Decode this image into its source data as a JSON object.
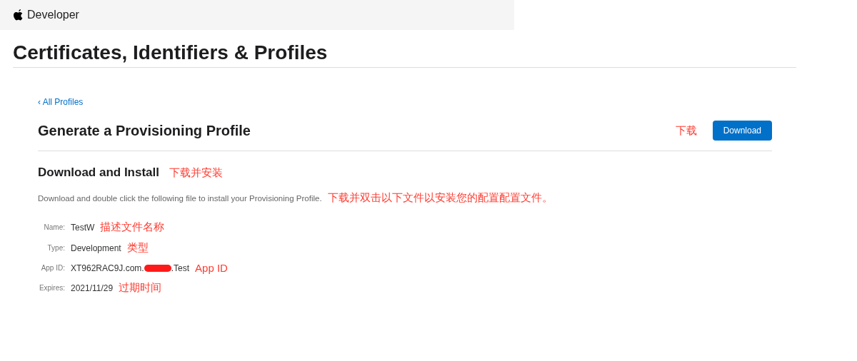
{
  "header": {
    "brand": "Developer"
  },
  "page_title": "Certificates, Identifiers & Profiles",
  "back_link": "‹ All Profiles",
  "section_title": "Generate a Provisioning Profile",
  "download_note": "下载",
  "download_button": "Download",
  "install": {
    "title": "Download and Install",
    "note": "下载并安装",
    "description": "Download and double click the following file to install your Provisioning Profile.",
    "description_note": "下载并双击以下文件以安装您的配置配置文件。"
  },
  "details": [
    {
      "label": "Name:",
      "value": "TestW",
      "note": "描述文件名称"
    },
    {
      "label": "Type:",
      "value": "Development",
      "note": "类型"
    },
    {
      "label": "App ID:",
      "value": "XT962RAC9J.com.",
      "redacted": true,
      "value_suffix": ".Test",
      "note": "App ID"
    },
    {
      "label": "Expires:",
      "value": "2021/11/29",
      "note": "过期时间"
    }
  ]
}
